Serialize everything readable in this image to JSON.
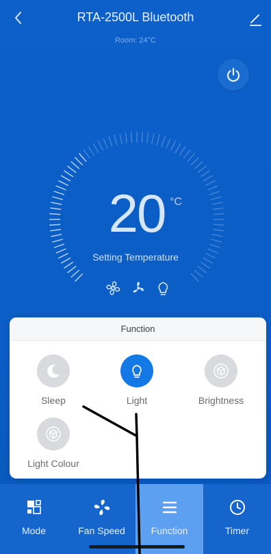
{
  "header": {
    "title": "RTA-2500L Bluetooth",
    "room": "Room: 24°C",
    "back_icon": "chevron-left-icon",
    "edit_icon": "pencil-icon",
    "power_icon": "power-icon"
  },
  "dial": {
    "temperature": "20",
    "unit": "°C",
    "label": "Setting Temperature",
    "mode_icons": [
      "fan-icon",
      "fan-speed-icon",
      "bulb-icon"
    ]
  },
  "function_panel": {
    "title": "Function",
    "items": [
      {
        "label": "Sleep",
        "icon": "moon-icon",
        "active": false
      },
      {
        "label": "Light",
        "icon": "bulb-icon",
        "active": true
      },
      {
        "label": "Brightness",
        "icon": "cube-icon",
        "active": false
      },
      {
        "label": "Light Colour",
        "icon": "cube-icon",
        "active": false
      }
    ]
  },
  "nav": {
    "items": [
      {
        "label": "Mode",
        "icon": "mode-grid-icon"
      },
      {
        "label": "Fan Speed",
        "icon": "fan-icon"
      },
      {
        "label": "Function",
        "icon": "menu-icon"
      },
      {
        "label": "Timer",
        "icon": "clock-icon"
      }
    ],
    "active": "Function"
  },
  "colors": {
    "background": "#0e5fc6",
    "accent": "#1478e5",
    "nav_active": "#5d9ff0",
    "panel": "#ffffff"
  }
}
